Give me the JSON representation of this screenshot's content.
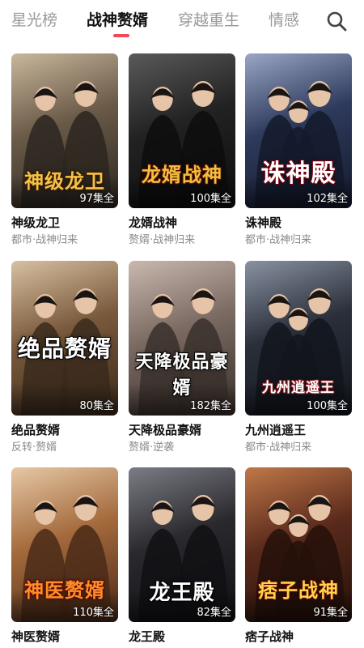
{
  "nav": {
    "tabs": [
      {
        "label": "星光榜",
        "active": false
      },
      {
        "label": "战神赘婿",
        "active": true
      },
      {
        "label": "穿越重生",
        "active": false
      },
      {
        "label": "情感",
        "active": false
      }
    ],
    "accent_color": "#f04b55",
    "search_icon": "search-icon"
  },
  "dramas": [
    {
      "title": "神级龙卫",
      "tags": "都市·战神归来",
      "episodes": "97集全",
      "poster_text": "神级龙卫",
      "palette": [
        "#6a5a48",
        "#c9b79c",
        "#2c2620"
      ]
    },
    {
      "title": "龙婿战神",
      "tags": "赘婿·战神归来",
      "episodes": "100集全",
      "poster_text": "龙婿战神",
      "palette": [
        "#222222",
        "#5a5a5a",
        "#0d0d0d"
      ]
    },
    {
      "title": "诛神殿",
      "tags": "都市·战神归来",
      "episodes": "102集全",
      "poster_text": "诛神殿",
      "palette": [
        "#2e3a5c",
        "#9aa6c4",
        "#141a2c"
      ]
    },
    {
      "title": "绝品赘婿",
      "tags": "反转·赘婿",
      "episodes": "80集全",
      "poster_text": "绝品赘婿",
      "palette": [
        "#7a5a3c",
        "#d8c0a2",
        "#3a2a1c"
      ]
    },
    {
      "title": "天降极品豪婿",
      "tags": "赘婿·逆袭",
      "episodes": "182集全",
      "poster_text": "天降极品豪婿",
      "palette": [
        "#7a6a62",
        "#c8b8ae",
        "#3a302c"
      ]
    },
    {
      "title": "九州逍遥王",
      "tags": "都市·战神归来",
      "episodes": "100集全",
      "poster_text": "九州逍遥王",
      "palette": [
        "#2a2f3a",
        "#8a92a2",
        "#12151c"
      ]
    },
    {
      "title": "神医赘婿",
      "tags": "",
      "episodes": "110集全",
      "poster_text": "神医赘婿",
      "palette": [
        "#a46a3c",
        "#e6c8a6",
        "#4a2a18"
      ]
    },
    {
      "title": "龙王殿",
      "tags": "",
      "episodes": "82集全",
      "poster_text": "龙王殿",
      "palette": [
        "#2a2a2e",
        "#7c7c86",
        "#101014"
      ]
    },
    {
      "title": "痞子战神",
      "tags": "",
      "episodes": "91集全",
      "poster_text": "痞子战神",
      "palette": [
        "#5a2a1c",
        "#c07848",
        "#24110a"
      ]
    }
  ]
}
